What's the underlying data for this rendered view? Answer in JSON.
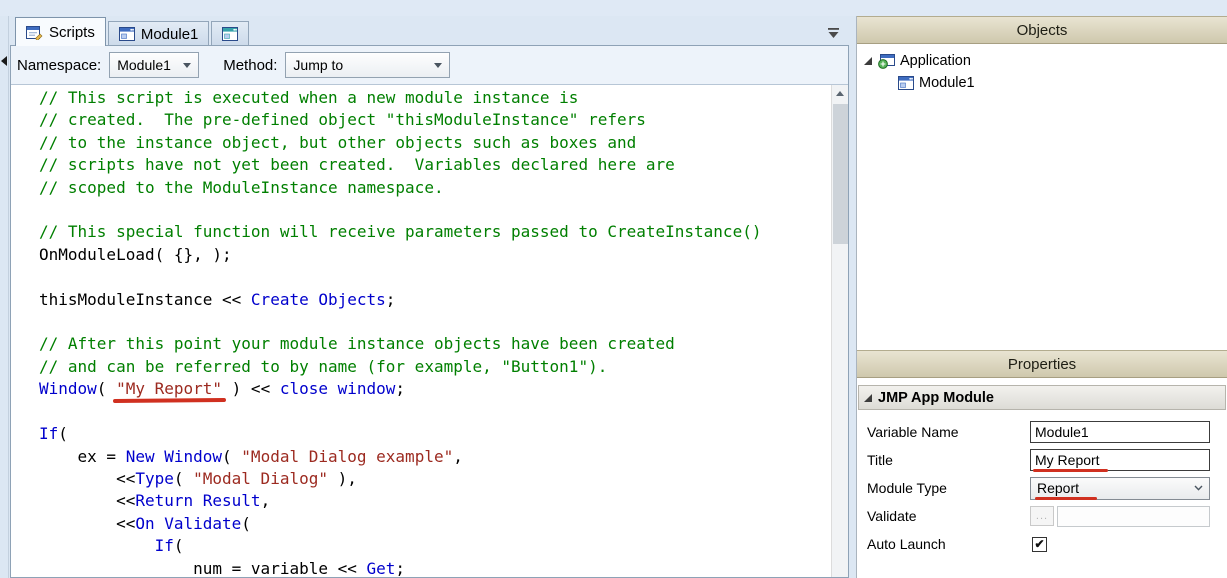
{
  "colors": {
    "comment": "#007f00",
    "keyword": "#0000cc",
    "string": "#9c2a20",
    "annotation_red": "#d03020",
    "panel_header_tan": "#d8d2bc"
  },
  "tabs": [
    {
      "id": "scripts",
      "label": "Scripts",
      "icon": "script",
      "active": true
    },
    {
      "id": "module1",
      "label": "Module1",
      "icon": "module",
      "active": false
    },
    {
      "id": "module-icon-only",
      "label": "",
      "icon": "module2",
      "active": false
    }
  ],
  "toolbar": {
    "namespace_label": "Namespace:",
    "namespace_value": "Module1",
    "method_label": "Method:",
    "method_value": "Jump to"
  },
  "code": {
    "lines": [
      [
        {
          "c": "cm",
          "t": "// This script is executed when a new module instance is"
        }
      ],
      [
        {
          "c": "cm",
          "t": "// created.  The pre-defined object \"thisModuleInstance\" refers"
        }
      ],
      [
        {
          "c": "cm",
          "t": "// to the instance object, but other objects such as boxes and"
        }
      ],
      [
        {
          "c": "cm",
          "t": "// scripts have not yet been created.  Variables declared here are"
        }
      ],
      [
        {
          "c": "cm",
          "t": "// scoped to the ModuleInstance namespace."
        }
      ],
      [],
      [
        {
          "c": "cm",
          "t": "// This special function will receive parameters passed to CreateInstance()"
        }
      ],
      [
        {
          "c": "pl",
          "t": "OnModuleLoad( {}, );"
        }
      ],
      [],
      [
        {
          "c": "pl",
          "t": "thisModuleInstance << "
        },
        {
          "c": "kw",
          "t": "Create Objects"
        },
        {
          "c": "pl",
          "t": ";"
        }
      ],
      [],
      [
        {
          "c": "cm",
          "t": "// After this point your module instance objects have been created"
        }
      ],
      [
        {
          "c": "cm",
          "t": "// and can be referred to by name (for example, \"Button1\")."
        }
      ],
      [
        {
          "c": "kw",
          "t": "Window"
        },
        {
          "c": "pl",
          "t": "( "
        },
        {
          "c": "st",
          "t": "\"My Report\"",
          "a": true
        },
        {
          "c": "pl",
          "t": " ) << "
        },
        {
          "c": "kw",
          "t": "close window"
        },
        {
          "c": "pl",
          "t": ";"
        }
      ],
      [],
      [
        {
          "c": "kw",
          "t": "If"
        },
        {
          "c": "pl",
          "t": "("
        }
      ],
      [
        {
          "c": "pl",
          "t": "    ex = "
        },
        {
          "c": "kw",
          "t": "New Window"
        },
        {
          "c": "pl",
          "t": "( "
        },
        {
          "c": "st",
          "t": "\"Modal Dialog example\""
        },
        {
          "c": "pl",
          "t": ","
        }
      ],
      [
        {
          "c": "pl",
          "t": "        <<"
        },
        {
          "c": "kw",
          "t": "Type"
        },
        {
          "c": "pl",
          "t": "( "
        },
        {
          "c": "st",
          "t": "\"Modal Dialog\""
        },
        {
          "c": "pl",
          "t": " ),"
        }
      ],
      [
        {
          "c": "pl",
          "t": "        <<"
        },
        {
          "c": "kw",
          "t": "Return Result"
        },
        {
          "c": "pl",
          "t": ","
        }
      ],
      [
        {
          "c": "pl",
          "t": "        <<"
        },
        {
          "c": "kw",
          "t": "On Validate"
        },
        {
          "c": "pl",
          "t": "("
        }
      ],
      [
        {
          "c": "pl",
          "t": "            "
        },
        {
          "c": "kw",
          "t": "If"
        },
        {
          "c": "pl",
          "t": "("
        }
      ],
      [
        {
          "c": "pl",
          "t": "                num = variable << "
        },
        {
          "c": "kw",
          "t": "Get"
        },
        {
          "c": "pl",
          "t": ";"
        }
      ]
    ]
  },
  "objects_panel": {
    "title": "Objects",
    "tree": [
      {
        "label": "Application",
        "icon": "application",
        "level": 0,
        "expanded": true
      },
      {
        "label": "Module1",
        "icon": "module",
        "level": 1,
        "expanded": null
      }
    ]
  },
  "properties_panel": {
    "title": "Properties",
    "section_title": "JMP App Module",
    "rows": [
      {
        "label": "Variable Name",
        "type": "text",
        "value": "Module1",
        "annotated": false
      },
      {
        "label": "Title",
        "type": "text",
        "value": "My Report",
        "annotated": true
      },
      {
        "label": "Module Type",
        "type": "dropdown",
        "value": "Report",
        "annotated": true
      },
      {
        "label": "Validate",
        "type": "validate",
        "value": "",
        "button_label": "...",
        "annotated": false
      },
      {
        "label": "Auto Launch",
        "type": "checkbox",
        "checked": true,
        "annotated": false
      }
    ]
  }
}
